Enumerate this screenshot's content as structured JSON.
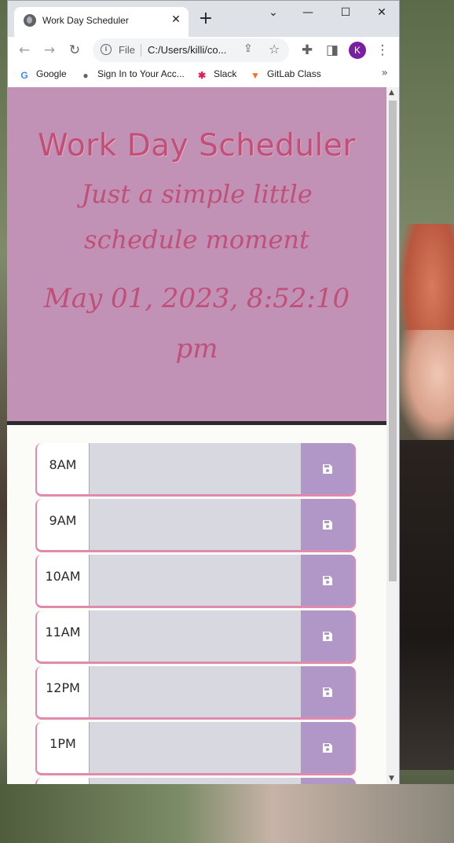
{
  "browser": {
    "tab_title": "Work Day Scheduler",
    "tab_close": "✕",
    "new_tab": "+",
    "window_controls": [
      "⌄",
      "—",
      "☐",
      "✕"
    ],
    "omnibox": {
      "scheme_label": "File",
      "url": "C:/Users/killi/co..."
    },
    "avatar_letter": "K",
    "bookmarks": [
      {
        "label": "Google",
        "icon": "google-icon"
      },
      {
        "label": "Sign In to Your Acc...",
        "icon": "globe-icon"
      },
      {
        "label": "Slack",
        "icon": "slack-icon"
      },
      {
        "label": "GitLab Class",
        "icon": "gitlab-icon"
      }
    ],
    "bookmarks_more": "»"
  },
  "header": {
    "title": "Work Day Scheduler",
    "lead": "Just a simple little schedule moment",
    "current_day": "May 01, 2023, 8:52:10 pm"
  },
  "schedule": {
    "hours": [
      "8AM",
      "9AM",
      "10AM",
      "11AM",
      "12PM",
      "1PM"
    ]
  },
  "colors": {
    "header_bg": "#c192b6",
    "title_text": "#c05078",
    "save_button": "#b196c8",
    "row_border": "#e08aad",
    "textarea_bg": "#d8d8e0"
  }
}
